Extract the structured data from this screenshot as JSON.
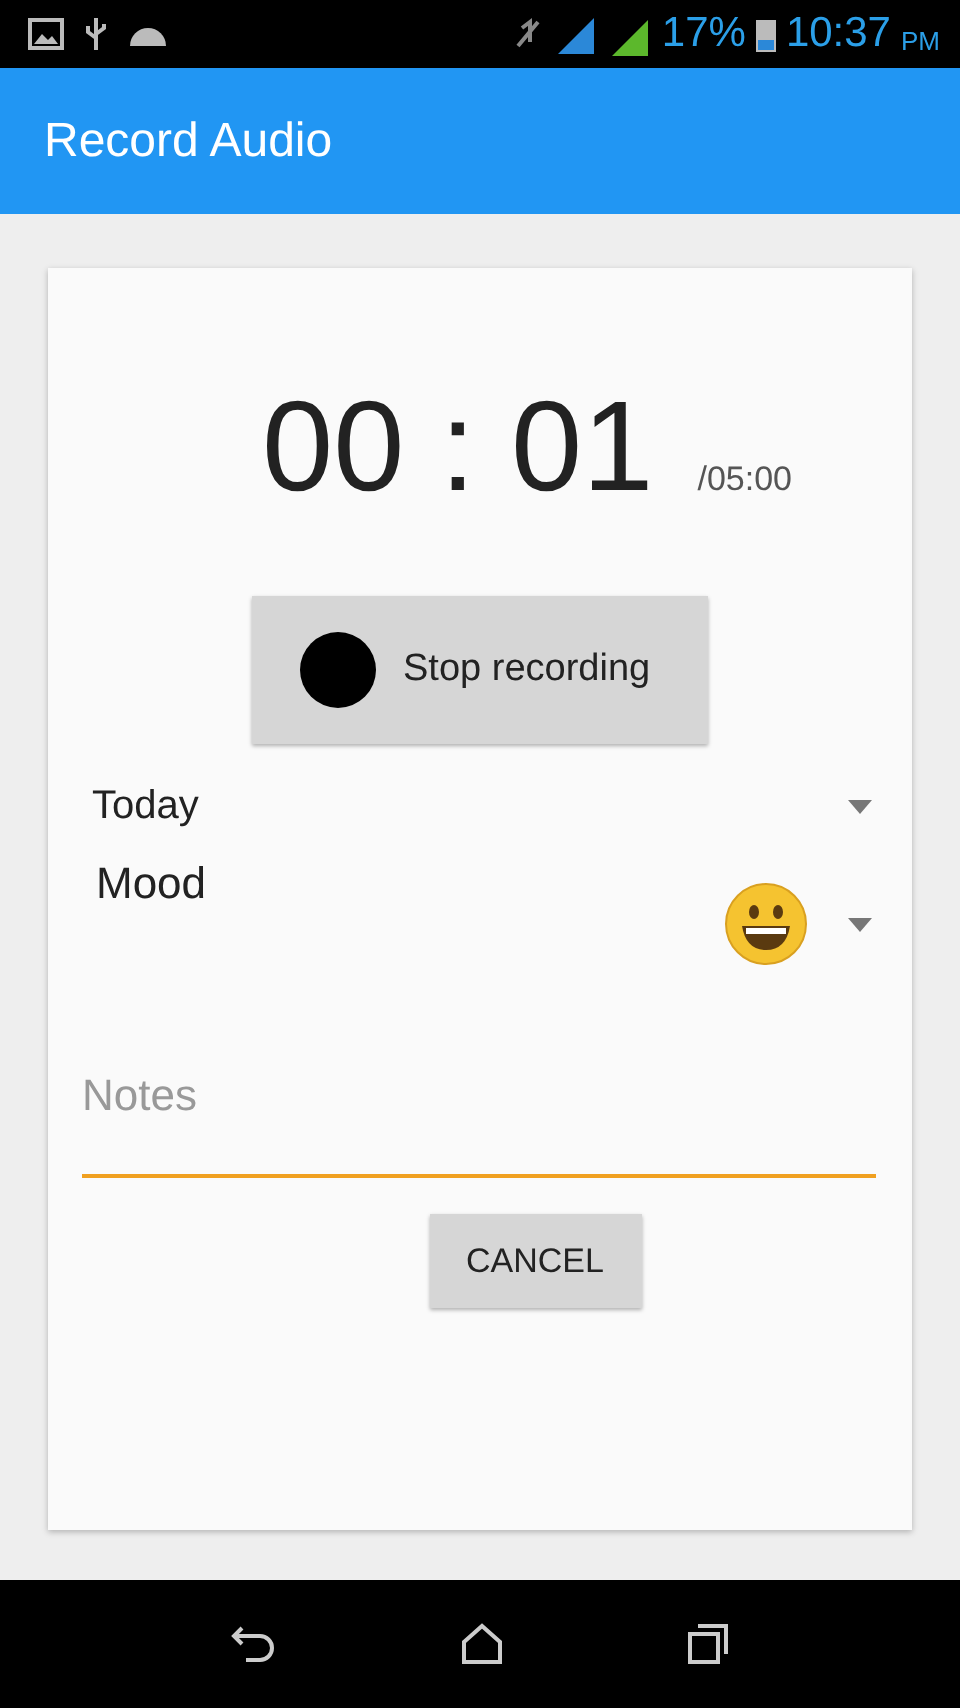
{
  "status_bar": {
    "battery": "17%",
    "time": "10:37",
    "ampm": "PM"
  },
  "app_bar": {
    "title": "Record Audio"
  },
  "timer": {
    "elapsed": "00 : 01",
    "limit": "/05:00"
  },
  "record_button": {
    "label": "Stop recording"
  },
  "date_spinner": {
    "value": "Today"
  },
  "mood_spinner": {
    "label": "Mood"
  },
  "notes": {
    "placeholder": "Notes",
    "focused": true
  },
  "buttons": [
    {
      "label": "CANCEL"
    }
  ]
}
